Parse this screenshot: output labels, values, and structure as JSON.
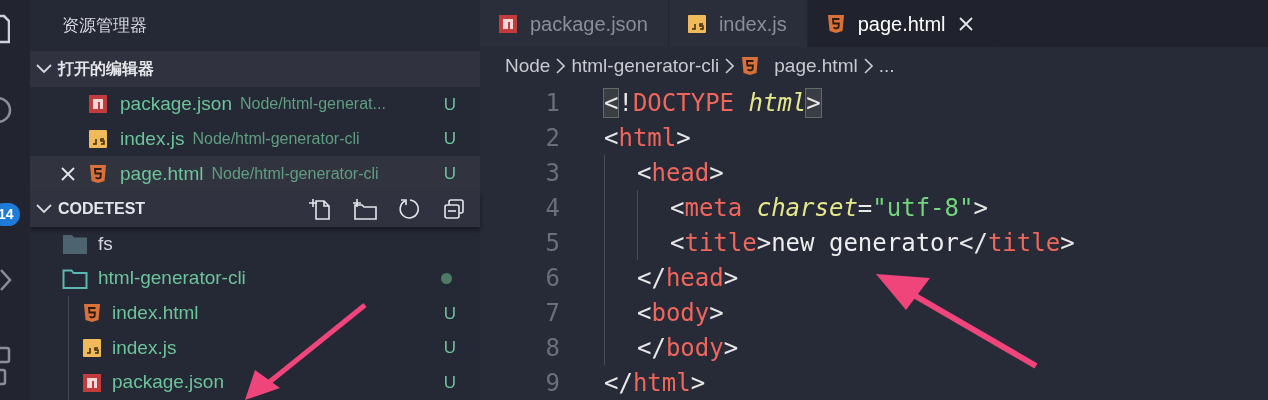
{
  "activity_bar": {
    "badge": "14"
  },
  "sidebar": {
    "title": "资源管理器",
    "open_editors": {
      "title": "打开的编辑器",
      "expanded": true,
      "items": [
        {
          "kind": "npm",
          "name": "package.json",
          "path": "Node/html-generat...",
          "status": "U",
          "selected": false
        },
        {
          "kind": "js",
          "name": "index.js",
          "path": "Node/html-generator-cli",
          "status": "U",
          "selected": false
        },
        {
          "kind": "html",
          "name": "page.html",
          "path": "Node/html-generator-cli",
          "status": "U",
          "selected": true
        }
      ]
    },
    "workspace": {
      "title": "CODETEST",
      "expanded": true,
      "items": [
        {
          "kind": "folder",
          "name": "fs",
          "expanded": false,
          "modified": false
        },
        {
          "kind": "folder",
          "name": "html-generator-cli",
          "expanded": true,
          "modified": true,
          "children": [
            {
              "kind": "html",
              "name": "index.html",
              "status": "U"
            },
            {
              "kind": "js",
              "name": "index.js",
              "status": "U"
            },
            {
              "kind": "npm",
              "name": "package.json",
              "status": "U"
            }
          ]
        }
      ]
    }
  },
  "tabs": [
    {
      "kind": "npm",
      "label": "package.json",
      "selected": false
    },
    {
      "kind": "js",
      "label": "index.js",
      "selected": false
    },
    {
      "kind": "html",
      "label": "page.html",
      "selected": true
    }
  ],
  "breadcrumb": [
    {
      "label": "Node"
    },
    {
      "label": "html-generator-cli"
    },
    {
      "kind": "html",
      "label": "page.html"
    },
    {
      "label": "..."
    }
  ],
  "code": [
    {
      "number": "1",
      "bracket_match": true,
      "tokens": [
        {
          "kind": "punct",
          "text": "<"
        },
        {
          "kind": "punct",
          "text": "!"
        },
        {
          "kind": "tag",
          "text": "DOCTYPE"
        },
        {
          "kind": "attr",
          "text": " html"
        },
        {
          "kind": "punct",
          "text": ">"
        }
      ]
    },
    {
      "number": "2",
      "bracket_match": false,
      "tokens": [
        {
          "kind": "punct",
          "text": "<"
        },
        {
          "kind": "tag",
          "text": "html"
        },
        {
          "kind": "punct",
          "text": ">"
        }
      ],
      "children": [
        {
          "number": "3",
          "bracket_match": false,
          "tokens": [
            {
              "kind": "punct",
              "text": "<"
            },
            {
              "kind": "tag",
              "text": "head"
            },
            {
              "kind": "punct",
              "text": ">"
            }
          ],
          "children": [
            {
              "number": "4",
              "bracket_match": false,
              "tokens": [
                {
                  "kind": "punct",
                  "text": "<"
                },
                {
                  "kind": "tag",
                  "text": "meta"
                },
                {
                  "kind": "attr",
                  "text": " charset"
                },
                {
                  "kind": "punct",
                  "text": "="
                },
                {
                  "kind": "string",
                  "text": "\"utf-8\""
                },
                {
                  "kind": "punct",
                  "text": ">"
                }
              ]
            },
            {
              "number": "5",
              "bracket_match": false,
              "tokens": [
                {
                  "kind": "punct",
                  "text": "<"
                },
                {
                  "kind": "tag",
                  "text": "title"
                },
                {
                  "kind": "punct",
                  "text": ">"
                },
                {
                  "kind": "text",
                  "text": "new generator"
                },
                {
                  "kind": "punct",
                  "text": "</"
                },
                {
                  "kind": "tag",
                  "text": "title"
                },
                {
                  "kind": "punct",
                  "text": ">"
                }
              ]
            }
          ]
        },
        {
          "number": "6",
          "bracket_match": false,
          "tokens": [
            {
              "kind": "punct",
              "text": "</"
            },
            {
              "kind": "tag",
              "text": "head"
            },
            {
              "kind": "punct",
              "text": ">"
            }
          ]
        },
        {
          "number": "7",
          "bracket_match": false,
          "tokens": [
            {
              "kind": "punct",
              "text": "<"
            },
            {
              "kind": "tag",
              "text": "body"
            },
            {
              "kind": "punct",
              "text": ">"
            }
          ]
        },
        {
          "number": "8",
          "bracket_match": false,
          "tokens": [
            {
              "kind": "punct",
              "text": "</"
            },
            {
              "kind": "tag",
              "text": "body"
            },
            {
              "kind": "punct",
              "text": ">"
            }
          ]
        }
      ]
    },
    {
      "number": "9",
      "bracket_match": false,
      "tokens": [
        {
          "kind": "punct",
          "text": "</"
        },
        {
          "kind": "tag",
          "text": "html"
        },
        {
          "kind": "punct",
          "text": ">"
        }
      ]
    }
  ]
}
